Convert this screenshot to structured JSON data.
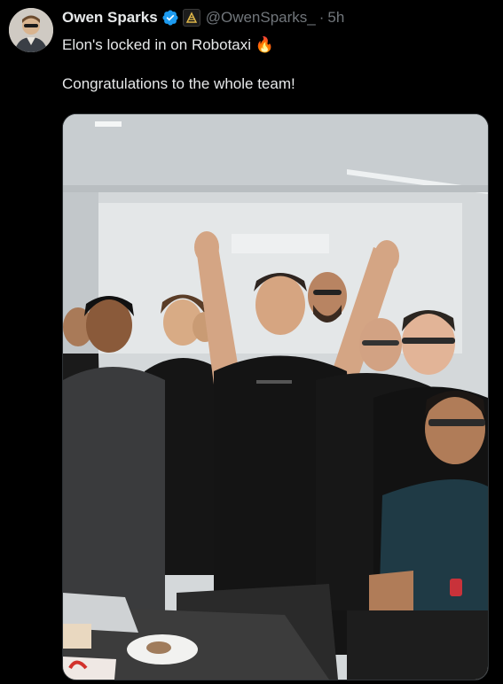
{
  "tweet": {
    "author_name": "Owen Sparks",
    "handle": "@OwenSparks_",
    "separator": "·",
    "time": "5h",
    "text_line1": "Elon's locked in on Robotaxi",
    "emoji": "🔥",
    "text_line2": "Congratulations to the whole team!"
  },
  "icons": {
    "verified": "verified-badge-icon",
    "affiliate": "affiliate-badge-icon"
  },
  "colors": {
    "background": "#000000",
    "text": "#e7e9ea",
    "secondary_text": "#71767b",
    "verified_blue": "#1d9bf0"
  }
}
